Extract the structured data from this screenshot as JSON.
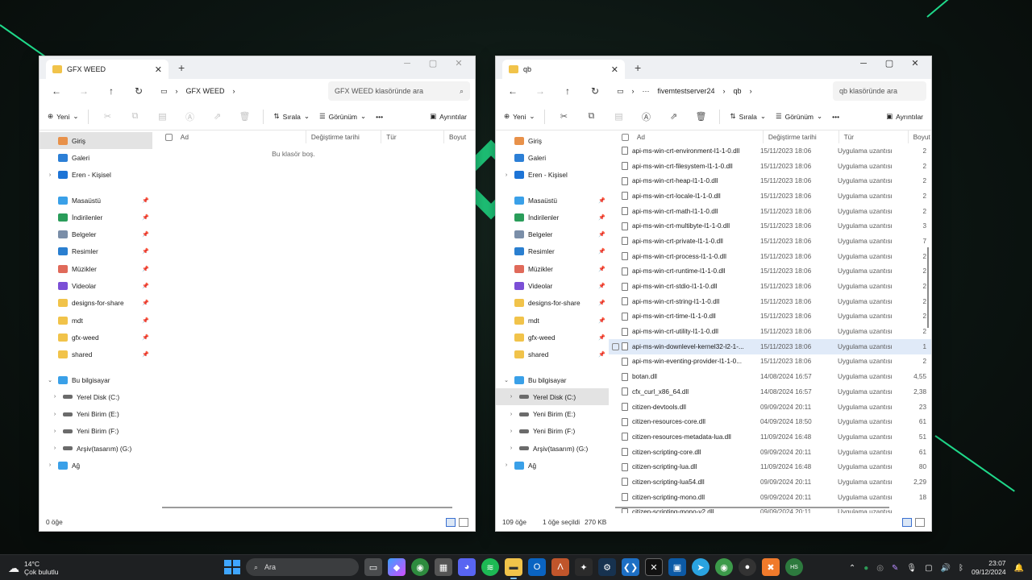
{
  "colors": {
    "accent": "#3a6fd0",
    "folder": "#f1c34a",
    "desktop_green": "#22e68c",
    "selection": "#e0eaf8"
  },
  "left_window": {
    "tab_title": "GFX WEED",
    "address": [
      "GFX WEED"
    ],
    "search_placeholder": "GFX WEED klasöründe ara",
    "toolbar": {
      "new": "Yeni",
      "sort": "Sırala",
      "view": "Görünüm",
      "details": "Ayrıntılar"
    },
    "columns": [
      "Ad",
      "Değiştirme tarihi",
      "Tür",
      "Boyut"
    ],
    "empty_message": "Bu klasör boş.",
    "status": "0 öğe"
  },
  "right_window": {
    "tab_title": "qb",
    "address": [
      "fivemtestserver24",
      "qb"
    ],
    "search_placeholder": "qb klasöründe ara",
    "toolbar": {
      "new": "Yeni",
      "sort": "Sırala",
      "view": "Görünüm",
      "details": "Ayrıntılar"
    },
    "columns": [
      "Ad",
      "Değiştirme tarihi",
      "Tür",
      "Boyut"
    ],
    "files": [
      {
        "name": "api-ms-win-crt-environment-l1-1-0.dll",
        "date": "15/11/2023 18:06",
        "type": "Uygulama uzantısı",
        "size": "2"
      },
      {
        "name": "api-ms-win-crt-filesystem-l1-1-0.dll",
        "date": "15/11/2023 18:06",
        "type": "Uygulama uzantısı",
        "size": "2"
      },
      {
        "name": "api-ms-win-crt-heap-l1-1-0.dll",
        "date": "15/11/2023 18:06",
        "type": "Uygulama uzantısı",
        "size": "2"
      },
      {
        "name": "api-ms-win-crt-locale-l1-1-0.dll",
        "date": "15/11/2023 18:06",
        "type": "Uygulama uzantısı",
        "size": "2"
      },
      {
        "name": "api-ms-win-crt-math-l1-1-0.dll",
        "date": "15/11/2023 18:06",
        "type": "Uygulama uzantısı",
        "size": "2"
      },
      {
        "name": "api-ms-win-crt-multibyte-l1-1-0.dll",
        "date": "15/11/2023 18:06",
        "type": "Uygulama uzantısı",
        "size": "3"
      },
      {
        "name": "api-ms-win-crt-private-l1-1-0.dll",
        "date": "15/11/2023 18:06",
        "type": "Uygulama uzantısı",
        "size": "7"
      },
      {
        "name": "api-ms-win-crt-process-l1-1-0.dll",
        "date": "15/11/2023 18:06",
        "type": "Uygulama uzantısı",
        "size": "2"
      },
      {
        "name": "api-ms-win-crt-runtime-l1-1-0.dll",
        "date": "15/11/2023 18:06",
        "type": "Uygulama uzantısı",
        "size": "2"
      },
      {
        "name": "api-ms-win-crt-stdio-l1-1-0.dll",
        "date": "15/11/2023 18:06",
        "type": "Uygulama uzantısı",
        "size": "2"
      },
      {
        "name": "api-ms-win-crt-string-l1-1-0.dll",
        "date": "15/11/2023 18:06",
        "type": "Uygulama uzantısı",
        "size": "2"
      },
      {
        "name": "api-ms-win-crt-time-l1-1-0.dll",
        "date": "15/11/2023 18:06",
        "type": "Uygulama uzantısı",
        "size": "2"
      },
      {
        "name": "api-ms-win-crt-utility-l1-1-0.dll",
        "date": "15/11/2023 18:06",
        "type": "Uygulama uzantısı",
        "size": "2"
      },
      {
        "name": "api-ms-win-downlevel-kernel32-l2-1-...",
        "date": "15/11/2023 18:06",
        "type": "Uygulama uzantısı",
        "size": "1",
        "selected": true
      },
      {
        "name": "api-ms-win-eventing-provider-l1-1-0...",
        "date": "15/11/2023 18:06",
        "type": "Uygulama uzantısı",
        "size": "2"
      },
      {
        "name": "botan.dll",
        "date": "14/08/2024 16:57",
        "type": "Uygulama uzantısı",
        "size": "4,55"
      },
      {
        "name": "cfx_curl_x86_64.dll",
        "date": "14/08/2024 16:57",
        "type": "Uygulama uzantısı",
        "size": "2,38"
      },
      {
        "name": "citizen-devtools.dll",
        "date": "09/09/2024 20:11",
        "type": "Uygulama uzantısı",
        "size": "23"
      },
      {
        "name": "citizen-resources-core.dll",
        "date": "04/09/2024 18:50",
        "type": "Uygulama uzantısı",
        "size": "61"
      },
      {
        "name": "citizen-resources-metadata-lua.dll",
        "date": "11/09/2024 16:48",
        "type": "Uygulama uzantısı",
        "size": "51"
      },
      {
        "name": "citizen-scripting-core.dll",
        "date": "09/09/2024 20:11",
        "type": "Uygulama uzantısı",
        "size": "61"
      },
      {
        "name": "citizen-scripting-lua.dll",
        "date": "11/09/2024 16:48",
        "type": "Uygulama uzantısı",
        "size": "80"
      },
      {
        "name": "citizen-scripting-lua54.dll",
        "date": "09/09/2024 20:11",
        "type": "Uygulama uzantısı",
        "size": "2,29"
      },
      {
        "name": "citizen-scripting-mono.dll",
        "date": "09/09/2024 20:11",
        "type": "Uygulama uzantısı",
        "size": "18"
      },
      {
        "name": "citizen-scripting-mono-v2.dll",
        "date": "09/09/2024 20:11",
        "type": "Uygulama uzantısı",
        "size": ""
      }
    ],
    "status": {
      "count": "109 öğe",
      "selected": "1 öğe seçildi",
      "size": "270 KB"
    }
  },
  "sidebar": {
    "top": [
      {
        "label": "Giriş",
        "icon": "home-icon"
      },
      {
        "label": "Galeri",
        "icon": "gallery-icon"
      },
      {
        "label": "Eren - Kişisel",
        "icon": "onedrive-icon"
      }
    ],
    "quick": [
      {
        "label": "Masaüstü",
        "icon": "desktop-icon"
      },
      {
        "label": "İndirilenler",
        "icon": "download-icon"
      },
      {
        "label": "Belgeler",
        "icon": "documents-icon"
      },
      {
        "label": "Resimler",
        "icon": "pictures-icon"
      },
      {
        "label": "Müzikler",
        "icon": "music-icon"
      },
      {
        "label": "Videolar",
        "icon": "videos-icon"
      },
      {
        "label": "designs-for-share",
        "icon": "folder-icon"
      },
      {
        "label": "mdt",
        "icon": "folder-icon"
      },
      {
        "label": "gfx-weed",
        "icon": "folder-icon"
      },
      {
        "label": "shared",
        "icon": "folder-icon"
      }
    ],
    "this_pc": "Bu bilgisayar",
    "drives": [
      "Yerel Disk (C:)",
      "Yeni Birim (E:)",
      "Yeni Birim (F:)",
      "Arşiv(tasarım) (G:)"
    ],
    "network": "Ağ"
  },
  "taskbar": {
    "weather_temp": "14°C",
    "weather_desc": "Çok bulutlu",
    "search": "Ara",
    "time": "23:07",
    "date": "09/12/2024"
  }
}
